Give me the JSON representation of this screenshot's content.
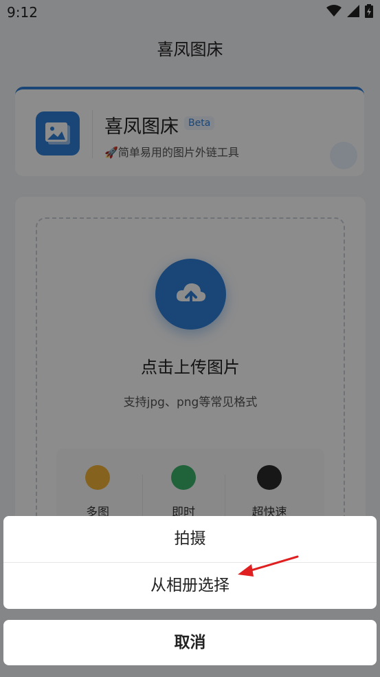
{
  "status_bar": {
    "time": "9:12"
  },
  "app": {
    "title": "喜凤图床"
  },
  "header": {
    "name": "喜凤图床",
    "badge": "Beta",
    "subtitle": "🚀简单易用的图片外链工具"
  },
  "upload": {
    "title": "点击上传图片",
    "hint": "支持jpg、png等常见格式"
  },
  "features": [
    {
      "label": "多图",
      "color": "#f2b53a"
    },
    {
      "label": "即时",
      "color": "#3bb36a"
    },
    {
      "label": "超快速",
      "color": "#2b2b2b"
    }
  ],
  "action_sheet": {
    "items": [
      "拍摄",
      "从相册选择"
    ],
    "cancel": "取消"
  },
  "colors": {
    "accent": "#2f80d9",
    "annotation_arrow": "#e02020"
  }
}
